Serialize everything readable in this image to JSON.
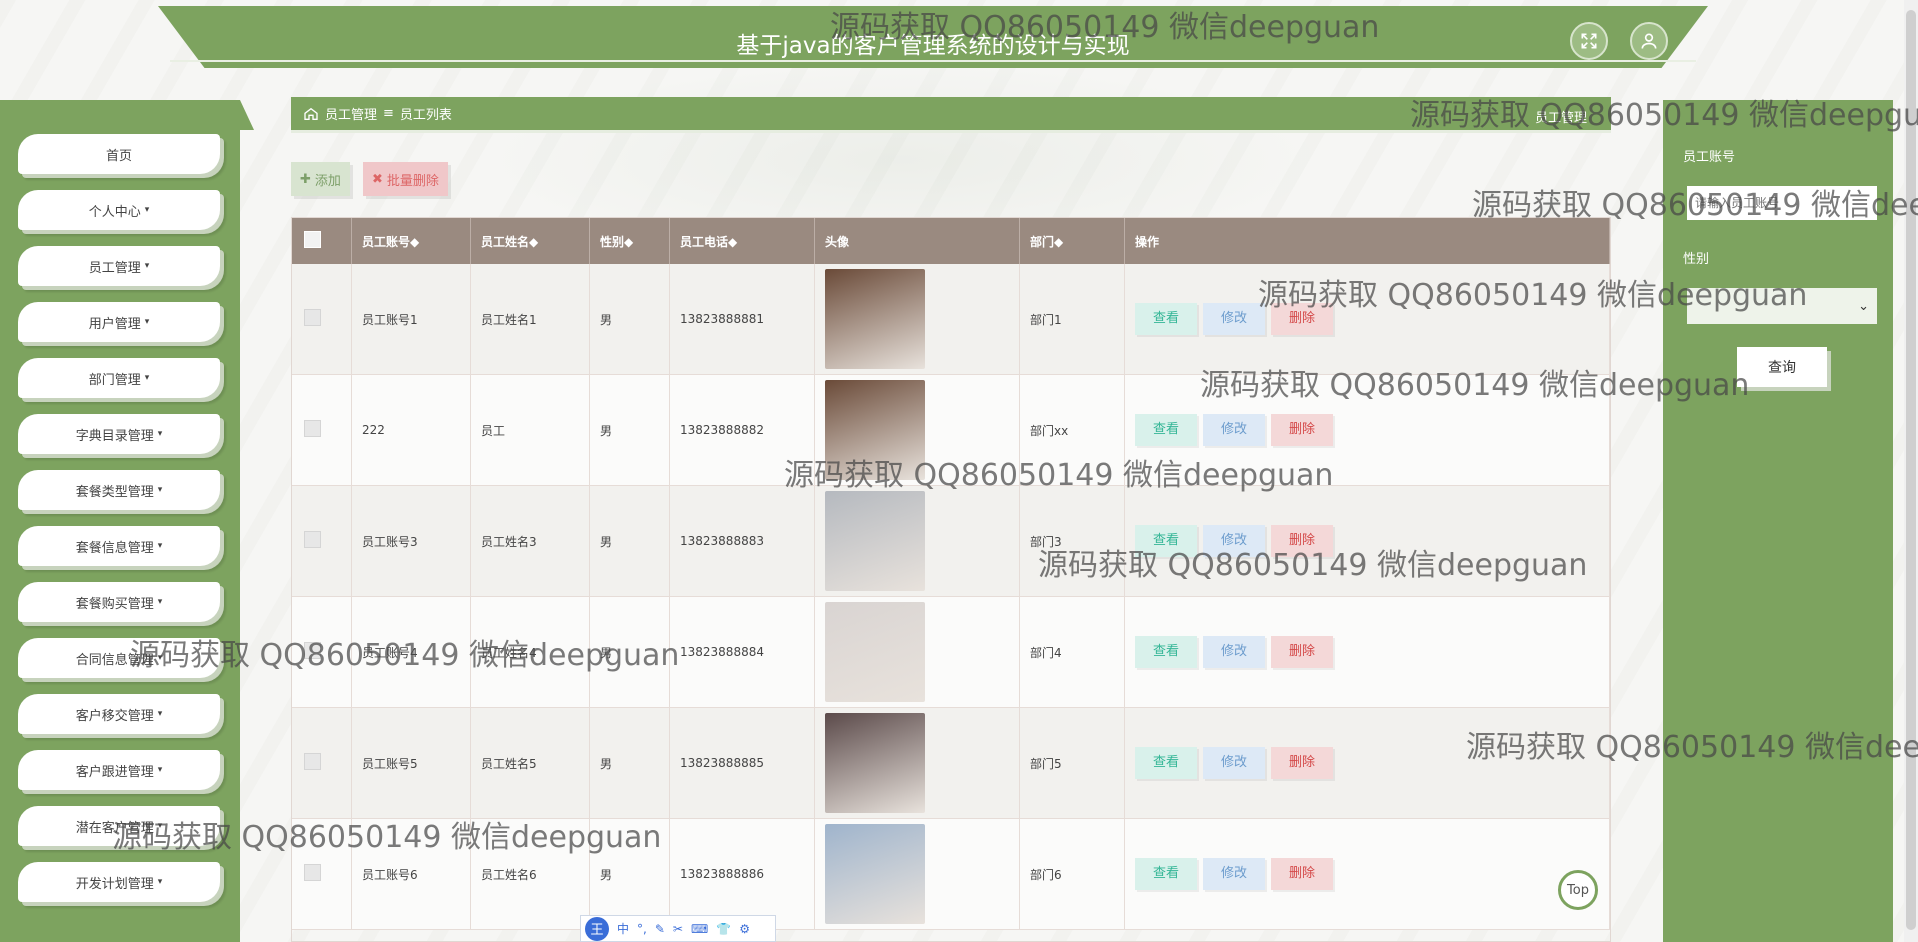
{
  "header": {
    "title": "基于java的客户管理系统的设计与实现",
    "fullscreen_icon": "expand-icon",
    "user_icon": "user-icon"
  },
  "sidebar": {
    "items": [
      {
        "label": "首页",
        "has_caret": false
      },
      {
        "label": "个人中心",
        "has_caret": true
      },
      {
        "label": "员工管理",
        "has_caret": true
      },
      {
        "label": "用户管理",
        "has_caret": true
      },
      {
        "label": "部门管理",
        "has_caret": true
      },
      {
        "label": "字典目录管理",
        "has_caret": true
      },
      {
        "label": "套餐类型管理",
        "has_caret": true
      },
      {
        "label": "套餐信息管理",
        "has_caret": true
      },
      {
        "label": "套餐购买管理",
        "has_caret": true
      },
      {
        "label": "合同信息管理",
        "has_caret": true
      },
      {
        "label": "客户移交管理",
        "has_caret": true
      },
      {
        "label": "客户跟进管理",
        "has_caret": true
      },
      {
        "label": "潜在客户管理",
        "has_caret": true
      },
      {
        "label": "开发计划管理",
        "has_caret": true
      }
    ],
    "caret": "▾"
  },
  "breadcrumb": {
    "home_icon": "home-icon",
    "section": "员工管理",
    "separator": "≡",
    "page": "员工列表",
    "right": "员工管理"
  },
  "toolbar": {
    "add_label": "添加",
    "add_icon": "✚",
    "batch_delete_label": "批量删除",
    "batch_delete_icon": "✖"
  },
  "table": {
    "headers": {
      "account": "员工账号◆",
      "name": "员工姓名◆",
      "gender": "性别◆",
      "phone": "员工电话◆",
      "avatar": "头像",
      "dept": "部门◆",
      "actions": "操作"
    },
    "action_labels": {
      "view": "查看",
      "edit": "修改",
      "delete": "删除"
    },
    "rows": [
      {
        "account": "员工账号1",
        "name": "员工姓名1",
        "gender": "男",
        "phone": "13823888881",
        "dept": "部门1",
        "avatar_color": "#6a4a38"
      },
      {
        "account": "222",
        "name": "员工",
        "gender": "男",
        "phone": "13823888882",
        "dept": "部门xx",
        "avatar_color": "#6a4a38"
      },
      {
        "account": "员工账号3",
        "name": "员工姓名3",
        "gender": "男",
        "phone": "13823888883",
        "dept": "部门3",
        "avatar_color": "#b5b9bf"
      },
      {
        "account": "员工账号4",
        "name": "员工姓名4",
        "gender": "男",
        "phone": "13823888884",
        "dept": "部门4",
        "avatar_color": "#d9d4d2"
      },
      {
        "account": "员工账号5",
        "name": "员工姓名5",
        "gender": "男",
        "phone": "13823888885",
        "dept": "部门5",
        "avatar_color": "#5b4a4a"
      },
      {
        "account": "员工账号6",
        "name": "员工姓名6",
        "gender": "男",
        "phone": "13823888886",
        "dept": "部门6",
        "avatar_color": "#9fb4cc"
      }
    ]
  },
  "search": {
    "account_label": "员工账号",
    "account_placeholder": "请输入员工账号",
    "gender_label": "性别",
    "gender_value": "",
    "query_label": "查询"
  },
  "misc": {
    "top_label": "Top",
    "ime_logo": "王",
    "ime_tools": [
      "中",
      "°,",
      "✎",
      "✂",
      "⌨",
      "👕",
      "⚙"
    ]
  },
  "watermark": "源码获取 QQ86050149 微信deepguan",
  "colors": {
    "primary_green": "#7da35f",
    "table_header": "#9a8a80",
    "view": "#34b696",
    "edit": "#6c9ccd",
    "delete": "#d44848"
  }
}
